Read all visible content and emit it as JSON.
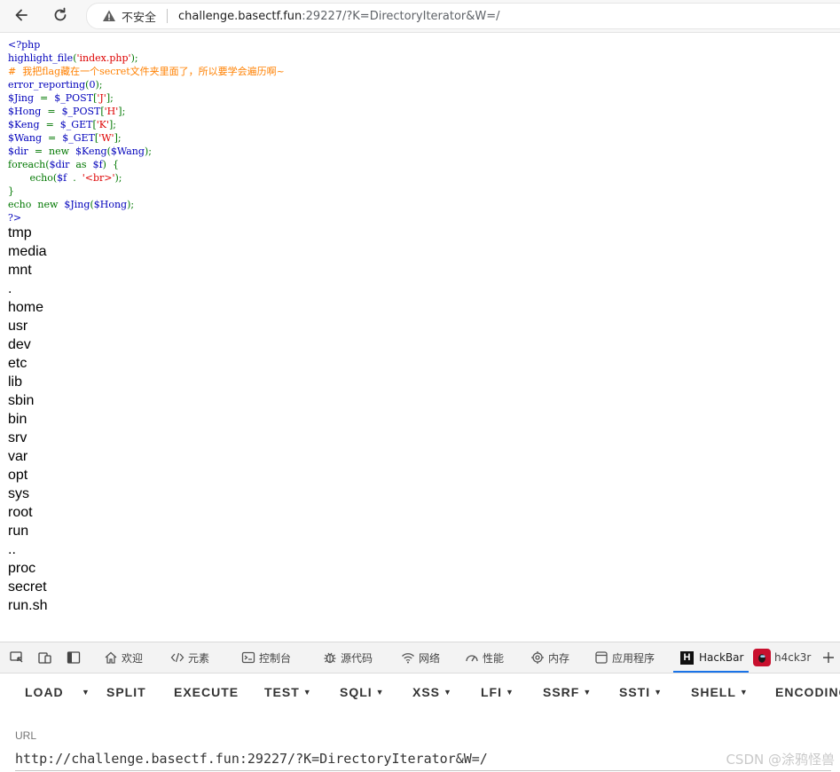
{
  "browser": {
    "security_label": "不安全",
    "url_host": "challenge.basectf.fun",
    "url_rest": ":29227/?K=DirectoryIterator&W=/"
  },
  "code_lines": [
    [
      {
        "t": "<?php",
        "c": "def"
      }
    ],
    [
      {
        "t": "highlight_file",
        "c": "def"
      },
      {
        "t": "(",
        "c": "kw"
      },
      {
        "t": "'index.php'",
        "c": "str"
      },
      {
        "t": ");",
        "c": "kw"
      }
    ],
    [
      {
        "t": "#  我把flag藏在一个secret文件夹里面了，所以要学会遍历啊~",
        "c": "cm"
      }
    ],
    [
      {
        "t": "error_reporting",
        "c": "def"
      },
      {
        "t": "(",
        "c": "kw"
      },
      {
        "t": "0",
        "c": "def"
      },
      {
        "t": ");",
        "c": "kw"
      }
    ],
    [
      {
        "t": "$Jing  ",
        "c": "def"
      },
      {
        "t": "=  ",
        "c": "kw"
      },
      {
        "t": "$_POST",
        "c": "def"
      },
      {
        "t": "[",
        "c": "kw"
      },
      {
        "t": "'J'",
        "c": "str"
      },
      {
        "t": "];",
        "c": "kw"
      }
    ],
    [
      {
        "t": "$Hong  ",
        "c": "def"
      },
      {
        "t": "=  ",
        "c": "kw"
      },
      {
        "t": "$_POST",
        "c": "def"
      },
      {
        "t": "[",
        "c": "kw"
      },
      {
        "t": "'H'",
        "c": "str"
      },
      {
        "t": "];",
        "c": "kw"
      }
    ],
    [
      {
        "t": "$Keng  ",
        "c": "def"
      },
      {
        "t": "=  ",
        "c": "kw"
      },
      {
        "t": "$_GET",
        "c": "def"
      },
      {
        "t": "[",
        "c": "kw"
      },
      {
        "t": "'K'",
        "c": "str"
      },
      {
        "t": "];",
        "c": "kw"
      }
    ],
    [
      {
        "t": "$Wang  ",
        "c": "def"
      },
      {
        "t": "=  ",
        "c": "kw"
      },
      {
        "t": "$_GET",
        "c": "def"
      },
      {
        "t": "[",
        "c": "kw"
      },
      {
        "t": "'W'",
        "c": "str"
      },
      {
        "t": "];",
        "c": "kw"
      }
    ],
    [
      {
        "t": "$dir  ",
        "c": "def"
      },
      {
        "t": "=  new  ",
        "c": "kw"
      },
      {
        "t": "$Keng",
        "c": "def"
      },
      {
        "t": "(",
        "c": "kw"
      },
      {
        "t": "$Wang",
        "c": "def"
      },
      {
        "t": ");",
        "c": "kw"
      }
    ],
    [
      {
        "t": "foreach(",
        "c": "kw"
      },
      {
        "t": "$dir  ",
        "c": "def"
      },
      {
        "t": "as  ",
        "c": "kw"
      },
      {
        "t": "$f",
        "c": "def"
      },
      {
        "t": ")  {",
        "c": "kw"
      }
    ],
    [
      {
        "t": "       echo(",
        "c": "kw"
      },
      {
        "t": "$f  ",
        "c": "def"
      },
      {
        "t": ".  ",
        "c": "kw"
      },
      {
        "t": "'<br>'",
        "c": "str"
      },
      {
        "t": ");",
        "c": "kw"
      }
    ],
    [
      {
        "t": "}",
        "c": "kw"
      }
    ],
    [
      {
        "t": "echo  new  ",
        "c": "kw"
      },
      {
        "t": "$Jing",
        "c": "def"
      },
      {
        "t": "(",
        "c": "kw"
      },
      {
        "t": "$Hong",
        "c": "def"
      },
      {
        "t": ");",
        "c": "kw"
      }
    ],
    [
      {
        "t": "?>",
        "c": "def"
      }
    ]
  ],
  "directory_entries": [
    "tmp",
    "media",
    "mnt",
    ".",
    "home",
    "usr",
    "dev",
    "etc",
    "lib",
    "sbin",
    "bin",
    "srv",
    "var",
    "opt",
    "sys",
    "root",
    "run",
    "..",
    "proc",
    "secret",
    "run.sh"
  ],
  "devtools": {
    "tabs": [
      "欢迎",
      "元素",
      "控制台",
      "源代码",
      "网络",
      "性能",
      "内存",
      "应用程序",
      "HackBar",
      "h4ck3r"
    ]
  },
  "hackbar": {
    "menu": [
      "LOAD",
      "SPLIT",
      "EXECUTE",
      "TEST",
      "SQLI",
      "XSS",
      "LFI",
      "SSRF",
      "SSTI",
      "SHELL",
      "ENCODING"
    ],
    "url_label": "URL",
    "url_value": "http://challenge.basectf.fun:29227/?K=DirectoryIterator&W=/"
  },
  "watermark": "CSDN @涂鸦怪兽",
  "colors": {
    "php_default": "#0000bb",
    "php_keyword": "#007700",
    "php_string": "#dd0000",
    "php_comment": "#ff8000",
    "active_tab_underline": "#1a73e8"
  }
}
